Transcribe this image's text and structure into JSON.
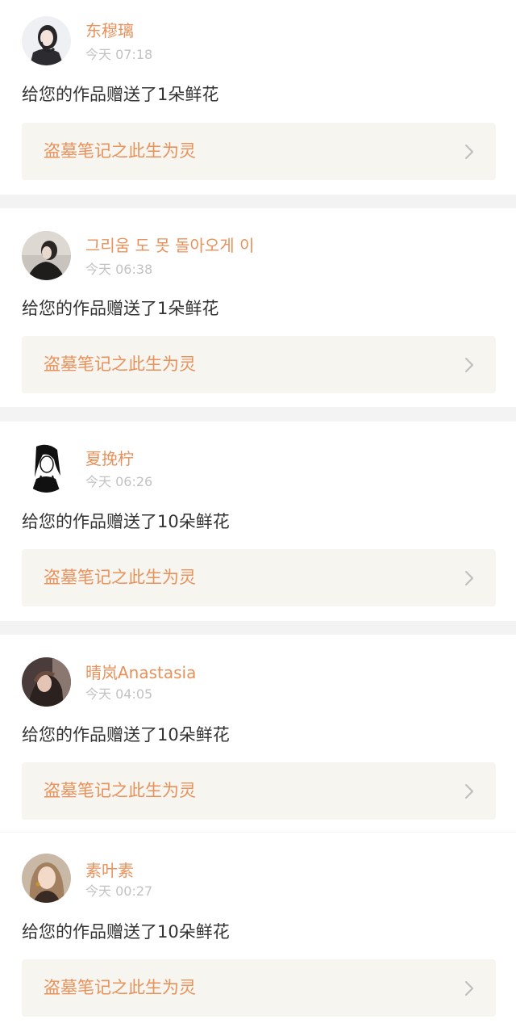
{
  "colors": {
    "accent": "#e8915b",
    "timestamp": "#c2c2c2",
    "text": "#333333",
    "card_link_bg": "#f6f5ef",
    "separator": "#f3f3f3"
  },
  "notifications": [
    {
      "username": "东穆璃",
      "time": "今天 07:18",
      "message": "给您的作品赠送了1朵鲜花",
      "work_title": "盗墓笔记之此生为灵",
      "avatar_icon": "user-avatar-icon",
      "chevron_icon": "chevron-right-icon"
    },
    {
      "username": "그리움 도 못 돌아오게 이",
      "time": "今天 06:38",
      "message": "给您的作品赠送了1朵鲜花",
      "work_title": "盗墓笔记之此生为灵",
      "avatar_icon": "user-avatar-icon",
      "chevron_icon": "chevron-right-icon"
    },
    {
      "username": "夏挽柠",
      "time": "今天 06:26",
      "message": "给您的作品赠送了10朵鲜花",
      "work_title": "盗墓笔记之此生为灵",
      "avatar_icon": "user-avatar-icon",
      "chevron_icon": "chevron-right-icon"
    },
    {
      "username": "晴岚Anastasia",
      "time": "今天 04:05",
      "message": "给您的作品赠送了10朵鲜花",
      "work_title": "盗墓笔记之此生为灵",
      "avatar_icon": "user-avatar-icon",
      "chevron_icon": "chevron-right-icon"
    },
    {
      "username": "素叶素",
      "time": "今天 00:27",
      "message": "给您的作品赠送了10朵鲜花",
      "work_title": "盗墓笔记之此生为灵",
      "avatar_icon": "user-avatar-icon",
      "chevron_icon": "chevron-right-icon"
    }
  ]
}
